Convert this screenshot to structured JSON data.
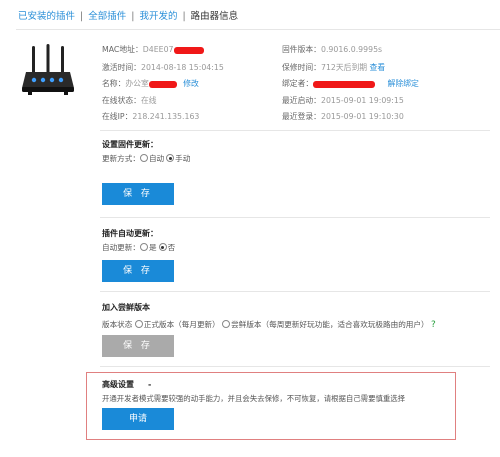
{
  "tabs": {
    "installed": "已安装的插件",
    "all": "全部插件",
    "mine": "我开发的",
    "current": "路由器信息",
    "sep": "|"
  },
  "info": {
    "mac_label": "MAC地址：",
    "mac_value": "D4EE07",
    "activated_label": "激活时间：",
    "activated_value": "2014-08-18 15:04:15",
    "name_label": "名称：",
    "name_value": "办公室",
    "name_edit": "修改",
    "online_label": "在线状态：",
    "online_value": "在线",
    "ip_label": "在线IP：",
    "ip_value": "218.241.135.163",
    "firmware_label": "固件版本：",
    "firmware_value": "0.9016.0.9995s",
    "warranty_label": "保修时间：",
    "warranty_value": "712天后到期",
    "warranty_view": "查看",
    "bind_label": "绑定者：",
    "unbind": "解除绑定",
    "last_start_label": "最近启动：",
    "last_start_value": "2015-09-01 19:09:15",
    "last_login_label": "最近登录：",
    "last_login_value": "2015-09-01 19:10:30"
  },
  "firmware_update": {
    "title": "设置固件更新：",
    "mode_label": "更新方式：",
    "opt_auto": "自动",
    "opt_manual": "手动",
    "selected": "manual",
    "button": "保 存"
  },
  "plugin_update": {
    "title": "插件自动更新：",
    "label": "自动更新：",
    "opt_yes": "是",
    "opt_no": "否",
    "selected": "no",
    "button": "保 存"
  },
  "beta": {
    "title": "加入尝鲜版本",
    "label": "版本状态",
    "opt_stable": "正式版本（每月更新）",
    "opt_beta": "尝鲜版本（每周更新好玩功能，适合喜欢玩极路由的用户）",
    "help": "?",
    "button": "保 存"
  },
  "advanced": {
    "title": "高级设置",
    "dash": "-",
    "desc": "开通开发者模式需要较强的动手能力，并且会失去保修，不可恢复，请根据自己需要慎重选择",
    "button": "申请"
  },
  "colors": {
    "accent": "#1a8ad8",
    "link": "#2a8fd8",
    "redact": "#f01818",
    "highlight_border": "#e08080"
  },
  "icons": [
    "router-icon",
    "radio-icon",
    "help-icon"
  ]
}
